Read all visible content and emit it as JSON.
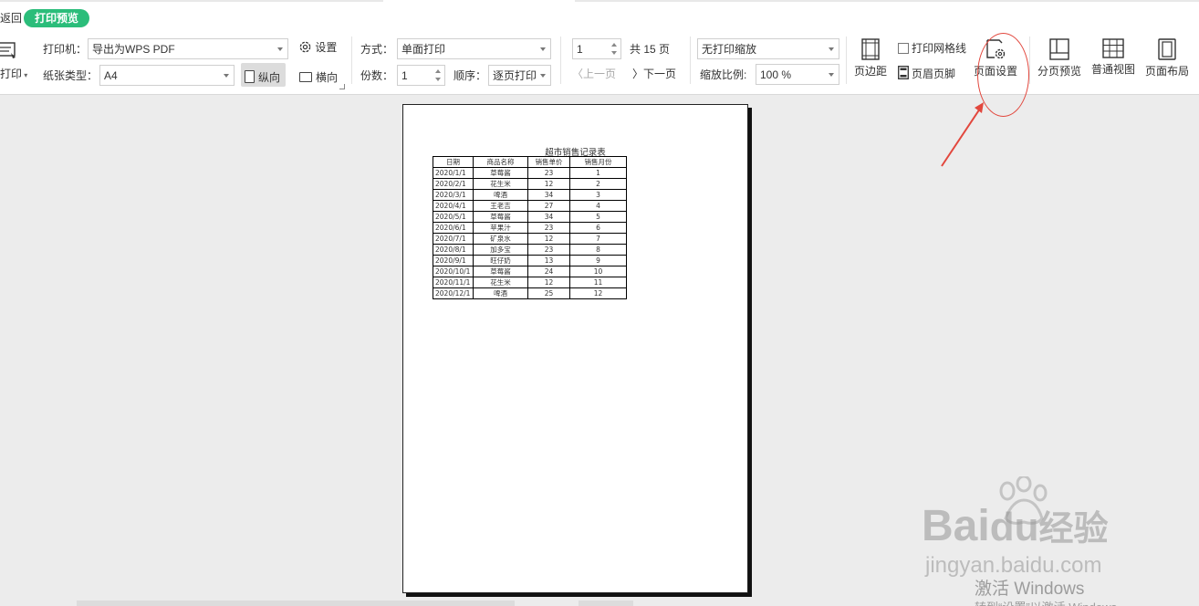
{
  "header": {
    "back_label": "返回",
    "mode_badge": "打印预览"
  },
  "print_group": {
    "print_label": "打印"
  },
  "printer": {
    "printer_label": "打印机：",
    "printer_value": "导出为WPS PDF",
    "settings_label": "设置",
    "paper_label": "纸张类型：",
    "paper_value": "A4",
    "portrait_label": "纵向",
    "landscape_label": "横向"
  },
  "copies": {
    "mode_label": "方式：",
    "mode_value": "单面打印",
    "copies_label": "份数：",
    "copies_value": "1",
    "order_label": "顺序：",
    "order_value": "逐页打印"
  },
  "pager": {
    "page_value": "1",
    "total_label": "共 15 页",
    "prev_label": "上一页",
    "next_label": "下一页"
  },
  "scaling": {
    "scale_mode_value": "无打印缩放",
    "zoom_label": "缩放比例:",
    "zoom_value": "100 %"
  },
  "layout_tools": {
    "margins_label": "页边距",
    "gridlines_label": "打印网格线",
    "header_footer_label": "页眉页脚",
    "page_setup_label": "页面设置"
  },
  "views": {
    "page_break_label": "分页预览",
    "normal_label": "普通视图",
    "page_layout_label": "页面布局"
  },
  "sheet": {
    "title": "超市销售记录表",
    "headers": [
      "日期",
      "商品名称",
      "销售单价",
      "销售月份"
    ],
    "rows": [
      [
        "2020/1/1",
        "草莓酱",
        "23",
        "1"
      ],
      [
        "2020/2/1",
        "花生米",
        "12",
        "2"
      ],
      [
        "2020/3/1",
        "啤酒",
        "34",
        "3"
      ],
      [
        "2020/4/1",
        "王老吉",
        "27",
        "4"
      ],
      [
        "2020/5/1",
        "草莓酱",
        "34",
        "5"
      ],
      [
        "2020/6/1",
        "苹果汁",
        "23",
        "6"
      ],
      [
        "2020/7/1",
        "矿泉水",
        "12",
        "7"
      ],
      [
        "2020/8/1",
        "加多宝",
        "23",
        "8"
      ],
      [
        "2020/9/1",
        "旺仔奶",
        "13",
        "9"
      ],
      [
        "2020/10/1",
        "草莓酱",
        "24",
        "10"
      ],
      [
        "2020/11/1",
        "花生米",
        "12",
        "11"
      ],
      [
        "2020/12/1",
        "啤酒",
        "25",
        "12"
      ]
    ]
  },
  "watermarks": {
    "brand_text": "Bai",
    "brand_suffix": "du",
    "brand_cn": "经验",
    "site": "jingyan.baidu.com",
    "activate_title": "激活 Windows",
    "activate_sub": "转到“设置”以激活 Windows。"
  },
  "colors": {
    "accent": "#2bbd7a",
    "annotation": "#e2473d",
    "page_border": "#222222"
  }
}
